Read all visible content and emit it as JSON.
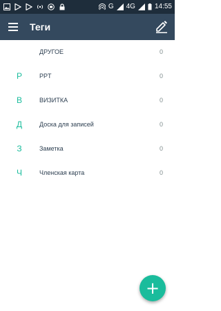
{
  "status_bar": {
    "network_label": "G",
    "network_type": "4G",
    "time": "14:55",
    "icons": [
      "image-icon",
      "play-store-icon",
      "play-store-icon",
      "wifi-hotspot-icon",
      "message-icon",
      "lock-icon",
      "hotspot-icon",
      "signal-icon",
      "signal-icon",
      "battery-icon"
    ]
  },
  "toolbar": {
    "title": "Теги",
    "menu_icon": "menu-icon",
    "edit_icon": "edit-icon"
  },
  "tags": [
    {
      "letter": "",
      "name": "ДРУГОЕ",
      "count": "0"
    },
    {
      "letter": "P",
      "name": "PPT",
      "count": "0"
    },
    {
      "letter": "В",
      "name": "ВИЗИТКА",
      "count": "0"
    },
    {
      "letter": "Д",
      "name": "Доска для записей",
      "count": "0"
    },
    {
      "letter": "З",
      "name": "Заметка",
      "count": "0"
    },
    {
      "letter": "Ч",
      "name": "Членская карта",
      "count": "0"
    }
  ],
  "fab": {
    "icon": "plus-icon",
    "symbol": "+"
  },
  "colors": {
    "status_bar": "#1e2d3b",
    "app_bar": "#34495e",
    "accent": "#1abc9c",
    "text": "#2c3e50",
    "count": "#7f8c8d"
  }
}
